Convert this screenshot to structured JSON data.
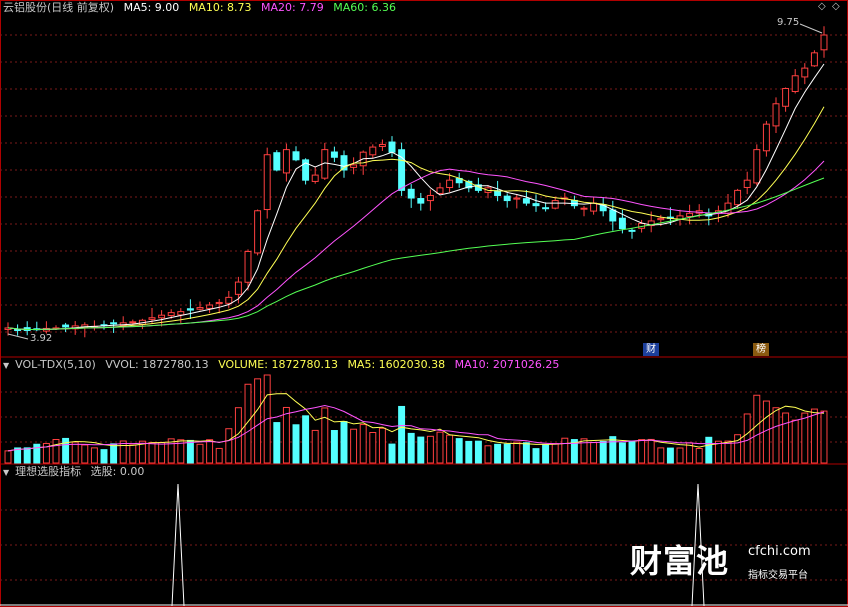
{
  "header": {
    "title": "云铝股份(日线 前复权)",
    "ma5": "MA5: 9.00",
    "ma10": "MA10: 8.73",
    "ma20": "MA20: 7.79",
    "ma60": "MA60: 6.36"
  },
  "price_panel": {
    "high_label": "9.75",
    "low_label": "3.92",
    "markers": [
      "财",
      "榜"
    ]
  },
  "volume_panel": {
    "name": "VOL-TDX(5,10)",
    "vvol": "VVOL: 1872780.13",
    "volume": "VOLUME: 1872780.13",
    "ma5": "MA5: 1602030.38",
    "ma10": "MA10: 2071026.25"
  },
  "indicator_panel": {
    "name": "理想选股指标",
    "value": "选股: 0.00"
  },
  "controls": {
    "diamond1": "◇",
    "diamond2": "◇"
  },
  "watermark": {
    "brand": "财富池",
    "site": "cfchi.com",
    "tagline": "指标交易平台"
  },
  "colors": {
    "up": "#ff4040",
    "down": "#54ffff",
    "ma5": "#ffffff",
    "ma10": "#ffff54",
    "ma20": "#ff54ff",
    "ma60": "#54ff54",
    "grid": "#7a1a1a",
    "border": "#b00000"
  },
  "chart_data": [
    {
      "type": "candlestick",
      "title": "云铝股份(日线 前复权)",
      "y_range": [
        3.92,
        9.75
      ],
      "annotated_high": 9.75,
      "annotated_low": 3.92,
      "ma_latest": {
        "MA5": 9.0,
        "MA10": 8.73,
        "MA20": 7.79,
        "MA60": 6.36
      },
      "series_close_approx": [
        4.0,
        3.96,
        3.95,
        3.97,
        3.99,
        4.0,
        4.02,
        4.04,
        4.06,
        4.03,
        4.05,
        4.08,
        4.1,
        4.12,
        4.15,
        4.2,
        4.25,
        4.3,
        4.32,
        4.35,
        4.4,
        4.45,
        4.5,
        4.6,
        4.9,
        5.5,
        6.3,
        7.4,
        7.1,
        7.5,
        7.3,
        6.9,
        7.0,
        7.5,
        7.35,
        7.1,
        7.2,
        7.45,
        7.55,
        7.6,
        7.45,
        6.7,
        6.55,
        6.45,
        6.6,
        6.75,
        6.9,
        6.85,
        6.75,
        6.7,
        6.75,
        6.6,
        6.5,
        6.55,
        6.45,
        6.4,
        6.35,
        6.5,
        6.55,
        6.4,
        6.35,
        6.45,
        6.3,
        6.1,
        5.95,
        5.9,
        6.05,
        6.1,
        6.15,
        6.15,
        6.2,
        6.25,
        6.3,
        6.2,
        6.3,
        6.45,
        6.7,
        6.9,
        7.5,
        8.0,
        8.4,
        8.7,
        8.95,
        9.1,
        9.4,
        9.75
      ]
    },
    {
      "type": "bar",
      "title": "VOL-TDX(5,10)",
      "latest": {
        "VOLUME": 1872780.13,
        "MA5": 1602030.38,
        "MA10": 2071026.25
      }
    },
    {
      "type": "line",
      "title": "理想选股指标",
      "latest": {
        "选股": 0.0
      },
      "signals": [
        0,
        1
      ]
    }
  ]
}
